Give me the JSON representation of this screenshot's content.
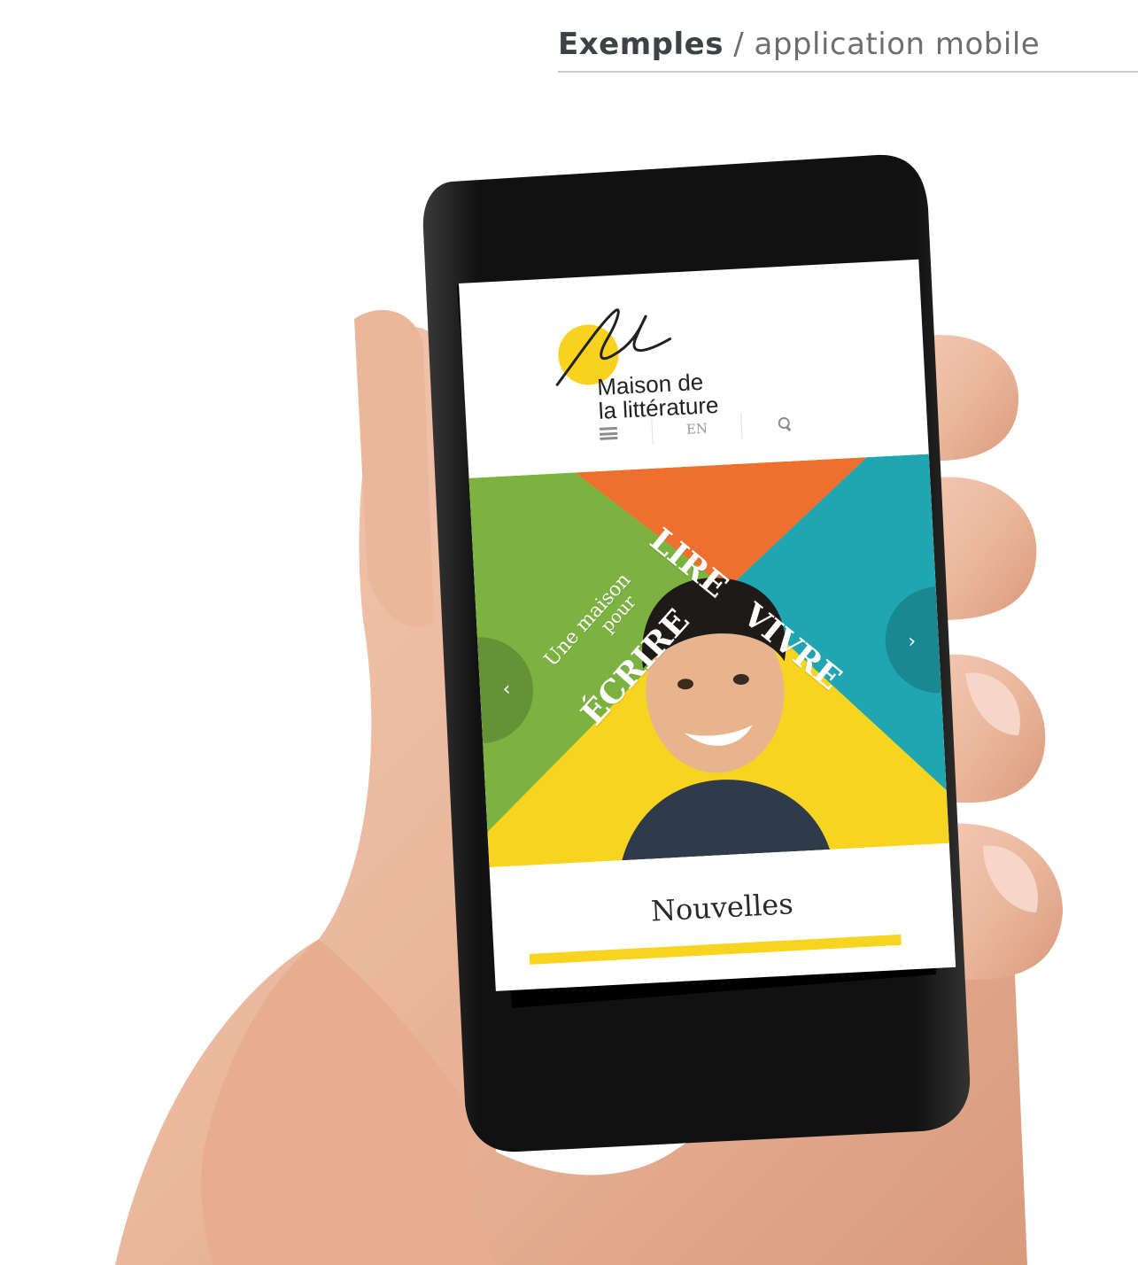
{
  "caption": {
    "strong": "Exemples",
    "rest": " / application mobile"
  },
  "site": {
    "logo_line1": "Maison de",
    "logo_line2": "la littérature",
    "lang_toggle": "EN",
    "hero_words": {
      "lire": "LIRE",
      "vivre": "VIVRE",
      "une_maison": "Une maison",
      "pour": "pour",
      "ecrire": "ÉCRIRE"
    },
    "arrow_prev": "‹",
    "arrow_next": "›",
    "news_heading": "Nouvelles"
  },
  "colors": {
    "yellow": "#f6d41f",
    "orange": "#ef6f2e",
    "green": "#7cb340",
    "teal": "#1fa6b1",
    "phone": "#111111"
  }
}
